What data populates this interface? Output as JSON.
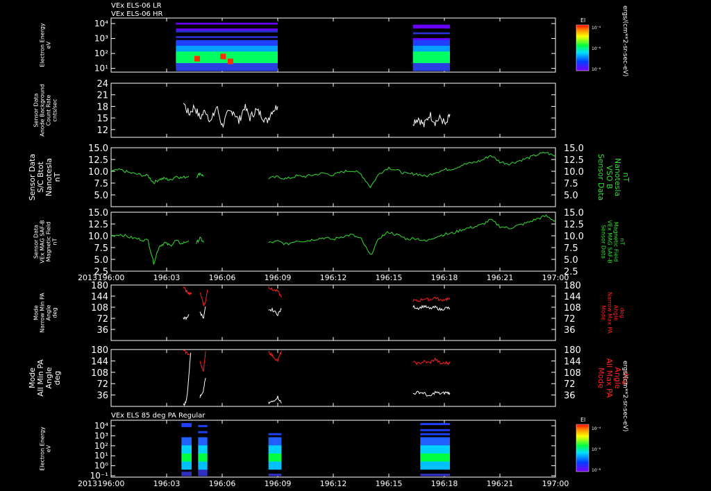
{
  "page": {
    "title_lines": [
      "VEx ELS-06 LR",
      "VEx ELS-06 HR"
    ],
    "bottom_title": "VEx ELS 85 deg PA Regular",
    "colorbar_unit": "ergs/(cm**2-sr-sec-eV)",
    "colorbar_label": "El",
    "colorbar_ticks": [
      "10⁻⁴",
      "10⁻⁶",
      "10⁻⁸"
    ],
    "year_label": "2013",
    "time_ticks": [
      "196:00",
      "196:03",
      "196:06",
      "196:09",
      "196:12",
      "196:15",
      "196:18",
      "196:21",
      "197:00"
    ],
    "colors": {
      "background": "#000000",
      "axis": "#ffffff",
      "green_trace": "#33dd33",
      "red_trace": "#ff2020",
      "white_trace": "#ffffff"
    }
  },
  "chart_data": [
    {
      "type": "heatmap",
      "name": "VEx ELS-06 LR / HR electron spectrogram",
      "ylabel": [
        "Electron Energy",
        "eV"
      ],
      "yscale": "log",
      "y_ticks": [
        "10⁴",
        "10³",
        "10²",
        "10¹"
      ],
      "x_units": "minutes after 196:00",
      "data_intervals": [
        [
          3.5,
          9.0
        ],
        [
          16.3,
          18.3
        ]
      ],
      "intense_energy_band_eV": [
        3,
        60
      ]
    },
    {
      "type": "line",
      "name": "Sensor Data Anode Background",
      "ylabel": [
        "Sensor Data",
        "Anode Background",
        "Count Rate",
        "cnts/sec"
      ],
      "ylim": [
        10,
        24
      ],
      "y_ticks": [
        "24",
        "21",
        "18",
        "15",
        "12"
      ],
      "series": [
        {
          "color": "white",
          "x": [
            3.9,
            4.2,
            4.5,
            4.8,
            5.1,
            5.4,
            5.7,
            6.0,
            6.3,
            6.6,
            6.9,
            7.2,
            7.5,
            7.8,
            8.1,
            8.4,
            8.7,
            9.0
          ],
          "y": [
            19,
            16,
            18,
            15,
            17,
            14,
            18,
            13,
            16,
            17,
            14,
            18,
            15,
            17,
            16,
            14,
            17,
            18
          ]
        },
        {
          "color": "white",
          "x": [
            16.3,
            16.6,
            16.9,
            17.2,
            17.5,
            17.8,
            18.1,
            18.3
          ],
          "y": [
            14,
            15,
            13,
            16,
            14,
            15,
            13,
            16
          ]
        }
      ]
    },
    {
      "type": "line",
      "name": "Sensor Data S/C Bnot",
      "ylabel": [
        "Sensor Data",
        "S/C Btot",
        "Nanotesla",
        "nT"
      ],
      "ylabel_right": [
        "Sensor Data",
        "VSO B",
        "Nanotesla",
        "nT"
      ],
      "ylim": [
        2.5,
        15.0
      ],
      "y_ticks": [
        "15.0",
        "12.5",
        "10.0",
        "7.5",
        "5.0"
      ],
      "series": [
        {
          "color": "green",
          "x": [
            0.0,
            0.5,
            1.0,
            1.5,
            2.0,
            2.3,
            2.6,
            2.9,
            3.2,
            3.5,
            3.8,
            4.2
          ],
          "y": [
            10.0,
            10.3,
            9.7,
            9.3,
            9.0,
            7.6,
            8.3,
            8.5,
            8.1,
            9.0,
            8.6,
            9.0
          ]
        },
        {
          "color": "green",
          "x": [
            4.6,
            4.8,
            5.0
          ],
          "y": [
            8.8,
            9.6,
            8.9
          ]
        },
        {
          "color": "green",
          "x": [
            8.5,
            9.0,
            9.5,
            10.0,
            10.5,
            11.0,
            11.5,
            12.0,
            12.5,
            13.0,
            13.5,
            14.0,
            14.5,
            15.0,
            15.5,
            16.0,
            16.5,
            17.0,
            17.5,
            18.0,
            18.5,
            19.0,
            19.5,
            20.0,
            20.5,
            21.0,
            21.5,
            22.0,
            22.5,
            23.0,
            23.5,
            24.0
          ],
          "y": [
            8.5,
            8.8,
            8.4,
            9.0,
            8.9,
            9.3,
            9.6,
            9.2,
            9.9,
            10.2,
            9.4,
            6.7,
            9.6,
            10.8,
            10.1,
            9.4,
            9.5,
            8.9,
            9.8,
            10.3,
            10.6,
            11.4,
            11.8,
            12.3,
            13.4,
            12.0,
            11.6,
            12.2,
            12.8,
            13.5,
            14.0,
            13.1
          ]
        }
      ]
    },
    {
      "type": "line",
      "name": "Sensor Data VEx MAG SAF-B Magnetic Field",
      "ylabel": [
        "Sensor Data",
        "VEx MAG SAF-B",
        "Magnetic Field",
        "nT"
      ],
      "ylabel_right": [
        "Sensor Data",
        "VEx MAG SAF-B",
        "Magnetic Field",
        "nT"
      ],
      "ylim": [
        2.5,
        15.0
      ],
      "y_ticks": [
        "15.0",
        "12.5",
        "10.0",
        "7.5",
        "5.0",
        "2.5"
      ],
      "series": [
        {
          "color": "green",
          "x": [
            0.0,
            0.5,
            1.0,
            1.5,
            2.0,
            2.3,
            2.6,
            2.9,
            3.2,
            3.5,
            3.8,
            4.2
          ],
          "y": [
            10.0,
            10.3,
            9.7,
            9.3,
            9.0,
            4.2,
            7.8,
            8.5,
            7.9,
            9.0,
            8.3,
            9.0
          ]
        },
        {
          "color": "green",
          "x": [
            4.6,
            4.8,
            5.0
          ],
          "y": [
            8.4,
            9.5,
            8.6
          ]
        },
        {
          "color": "green",
          "x": [
            8.5,
            9.0,
            9.5,
            10.0,
            10.5,
            11.0,
            11.5,
            12.0,
            12.5,
            13.0,
            13.5,
            14.0,
            14.5,
            15.0,
            15.5,
            16.0,
            16.5,
            17.0,
            17.5,
            18.0,
            18.5,
            19.0,
            19.5,
            20.0,
            20.5,
            21.0,
            21.5,
            22.0,
            22.5,
            23.0,
            23.5,
            24.0
          ],
          "y": [
            8.5,
            8.8,
            8.2,
            9.0,
            8.9,
            9.3,
            9.6,
            9.2,
            9.9,
            10.2,
            9.3,
            5.8,
            9.6,
            10.8,
            10.1,
            9.3,
            9.5,
            8.8,
            9.8,
            10.3,
            10.6,
            11.4,
            11.8,
            12.3,
            13.4,
            12.0,
            11.6,
            12.2,
            12.8,
            13.6,
            14.2,
            13.1
          ]
        }
      ]
    },
    {
      "type": "line",
      "name": "Mode Narrow Min/Max PA Angle",
      "ylabel": [
        "Mode",
        "Narrow Min PA",
        "Angle",
        "deg"
      ],
      "ylabel_right": [
        "Mode",
        "Narrow Max PA",
        "Angle",
        "deg"
      ],
      "ylim": [
        0,
        180
      ],
      "y_ticks": [
        "180",
        "144",
        "108",
        "72",
        "36"
      ],
      "series": [
        {
          "color": "red",
          "x": [
            3.9,
            4.05,
            4.2,
            4.35
          ],
          "y": [
            175,
            160,
            155,
            150
          ]
        },
        {
          "color": "red",
          "x": [
            4.8,
            5.0,
            5.1,
            5.2
          ],
          "y": [
            160,
            115,
            125,
            165
          ]
        },
        {
          "color": "red",
          "x": [
            8.5,
            8.7,
            9.0,
            9.2
          ],
          "y": [
            175,
            165,
            160,
            140
          ]
        },
        {
          "color": "red",
          "x": [
            16.3,
            16.6,
            16.9,
            17.2,
            17.5,
            17.8,
            18.1,
            18.3
          ],
          "y": [
            130,
            128,
            136,
            132,
            140,
            130,
            135,
            133
          ]
        },
        {
          "color": "white",
          "x": [
            3.9,
            4.05,
            4.2
          ],
          "y": [
            75,
            70,
            85
          ]
        },
        {
          "color": "white",
          "x": [
            4.8,
            5.0,
            5.1
          ],
          "y": [
            90,
            75,
            110
          ]
        },
        {
          "color": "white",
          "x": [
            8.5,
            8.7,
            9.0,
            9.2
          ],
          "y": [
            95,
            100,
            85,
            102
          ]
        },
        {
          "color": "white",
          "x": [
            16.3,
            16.6,
            16.9,
            17.2,
            17.5,
            17.8,
            18.1,
            18.3
          ],
          "y": [
            110,
            105,
            112,
            103,
            108,
            100,
            106,
            104
          ]
        }
      ]
    },
    {
      "type": "line",
      "name": "Mode All Min/Max PA Angle",
      "ylabel": [
        "Mode",
        "All Min PA",
        "Angle",
        "deg"
      ],
      "ylabel_right": [
        "Mode",
        "All Max PA",
        "Angle",
        "deg"
      ],
      "ylim": [
        0,
        180
      ],
      "y_ticks": [
        "180",
        "144",
        "108",
        "72",
        "36"
      ],
      "series": [
        {
          "color": "red",
          "x": [
            3.9,
            4.1,
            4.3
          ],
          "y": [
            175,
            170,
            160
          ]
        },
        {
          "color": "red",
          "x": [
            4.8,
            5.0,
            5.1
          ],
          "y": [
            140,
            112,
            175
          ]
        },
        {
          "color": "red",
          "x": [
            8.5,
            8.7,
            9.0,
            9.2
          ],
          "y": [
            175,
            160,
            145,
            175
          ]
        },
        {
          "color": "red",
          "x": [
            16.3,
            16.6,
            16.9,
            17.2,
            17.5,
            17.8,
            18.1,
            18.3
          ],
          "y": [
            140,
            135,
            142,
            138,
            150,
            135,
            138,
            137
          ]
        },
        {
          "color": "white",
          "x": [
            3.9,
            4.0,
            4.1,
            4.2,
            4.3
          ],
          "y": [
            5,
            10,
            30,
            100,
            170
          ]
        },
        {
          "color": "white",
          "x": [
            4.8,
            4.95,
            5.1
          ],
          "y": [
            30,
            40,
            90
          ]
        },
        {
          "color": "white",
          "x": [
            8.5,
            8.7,
            9.0,
            9.2
          ],
          "y": [
            10,
            15,
            30,
            10
          ]
        },
        {
          "color": "white",
          "x": [
            16.3,
            16.6,
            16.9,
            17.2,
            17.5,
            17.8,
            18.1,
            18.3
          ],
          "y": [
            40,
            45,
            42,
            30,
            45,
            40,
            44,
            42
          ]
        }
      ]
    },
    {
      "type": "heatmap",
      "name": "VEx ELS 85 deg PA Regular",
      "ylabel": [
        "Electron Energy",
        "eV"
      ],
      "yscale": "log",
      "y_ticks": [
        "10⁴",
        "10³",
        "10²",
        "10¹",
        "10⁰",
        "10⁻¹"
      ],
      "x_units": "minutes after 196:00",
      "data_intervals": [
        [
          3.8,
          4.35
        ],
        [
          4.7,
          5.2
        ],
        [
          8.5,
          9.2
        ],
        [
          16.7,
          18.3
        ]
      ],
      "intense_energy_band_eV": [
        1,
        60
      ]
    }
  ]
}
